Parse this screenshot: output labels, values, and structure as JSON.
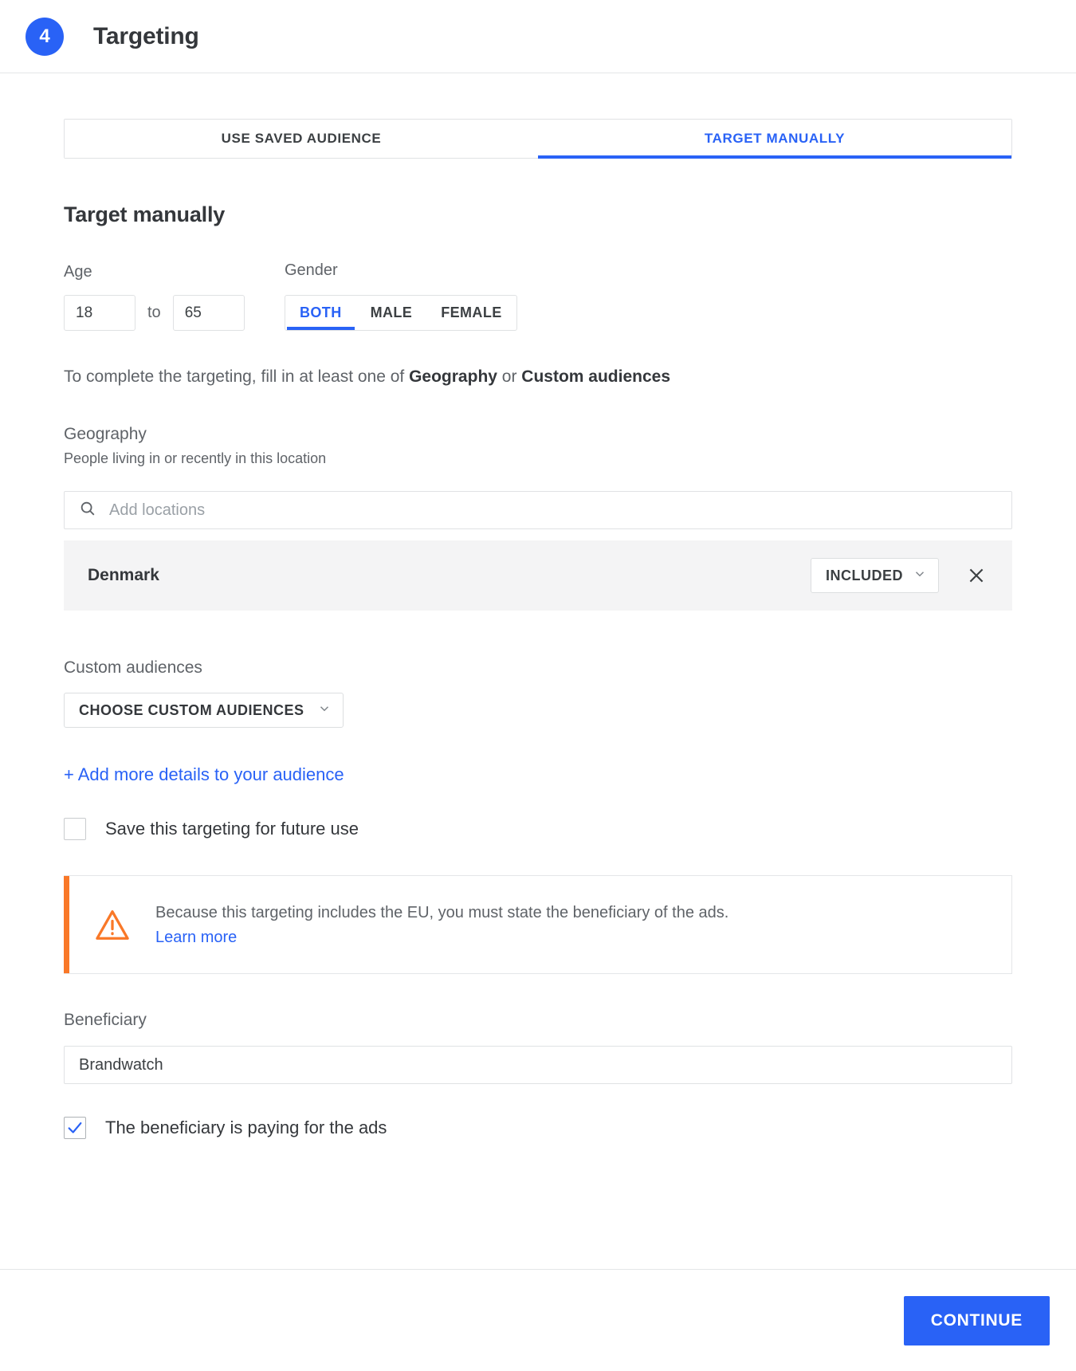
{
  "header": {
    "step_number": "4",
    "title": "Targeting"
  },
  "tabs": [
    {
      "label": "USE SAVED AUDIENCE",
      "active": false
    },
    {
      "label": "TARGET MANUALLY",
      "active": true
    }
  ],
  "section": {
    "title": "Target manually"
  },
  "age": {
    "label": "Age",
    "from_value": "18",
    "to_label": "to",
    "to_value": "65"
  },
  "gender": {
    "label": "Gender",
    "options": [
      "BOTH",
      "MALE",
      "FEMALE"
    ],
    "selected": "BOTH"
  },
  "helper": {
    "prefix": "To complete the targeting, fill in at least one of ",
    "bold_1": "Geography",
    "middle": " or ",
    "bold_2": "Custom audiences"
  },
  "geography": {
    "title": "Geography",
    "subtitle": "People living in or recently in this location",
    "search_placeholder": "Add locations",
    "search_value": "",
    "locations": [
      {
        "name": "Denmark",
        "status": "INCLUDED"
      }
    ]
  },
  "custom_audiences": {
    "title": "Custom audiences",
    "select_label": "CHOOSE CUSTOM AUDIENCES"
  },
  "add_details_link": "+ Add more details to your audience",
  "save_targeting": {
    "label": "Save this targeting for future use",
    "checked": false
  },
  "warning": {
    "text": "Because this targeting includes the EU, you must state the beneficiary of the ads.",
    "link": "Learn more"
  },
  "beneficiary": {
    "label": "Beneficiary",
    "value": "Brandwatch",
    "paying_label": "The beneficiary is paying for the ads",
    "paying_checked": true
  },
  "footer": {
    "continue_label": "CONTINUE"
  },
  "colors": {
    "accent": "#2962f6",
    "warning": "#f97828",
    "row_bg": "#f4f4f5",
    "text": "#34373b",
    "muted": "#5f6368"
  }
}
